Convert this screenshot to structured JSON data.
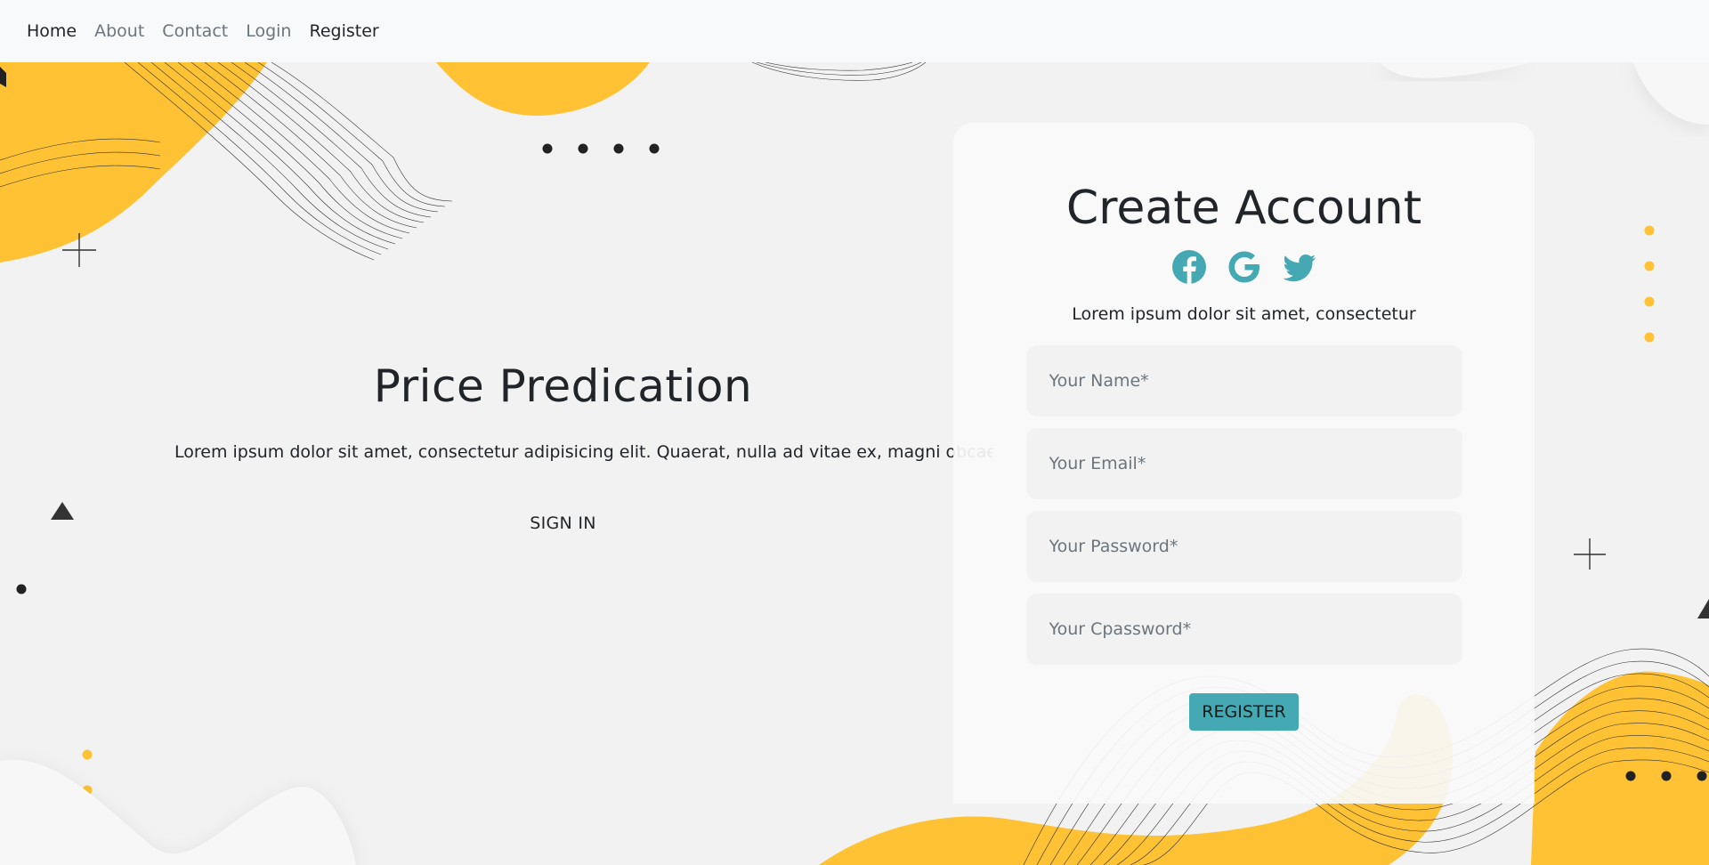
{
  "nav": {
    "items": [
      {
        "label": "Home"
      },
      {
        "label": "About"
      },
      {
        "label": "Contact"
      },
      {
        "label": "Login"
      },
      {
        "label": "Register"
      }
    ]
  },
  "hero": {
    "title": "Price Predication",
    "text": "Lorem ipsum dolor sit amet, consectetur adipisicing elit. Quaerat, nulla ad vitae ex, magni obcaecati",
    "signin_label": "SIGN IN"
  },
  "card": {
    "title": "Create Account",
    "subtitle": "Lorem ipsum dolor sit amet, consectetur",
    "socials": [
      "facebook-icon",
      "google-icon",
      "twitter-icon"
    ],
    "fields": {
      "name": {
        "placeholder": "Your Name*",
        "value": ""
      },
      "email": {
        "placeholder": "Your Email*",
        "value": ""
      },
      "password": {
        "placeholder": "Your Password*",
        "value": ""
      },
      "cpassword": {
        "placeholder": "Your Cpassword*",
        "value": ""
      }
    },
    "register_label": "REGISTER"
  },
  "colors": {
    "accent": "#45a9b3",
    "yellow": "#ffc234",
    "background": "#f2f2f2",
    "navbar": "#f8f9fa"
  }
}
